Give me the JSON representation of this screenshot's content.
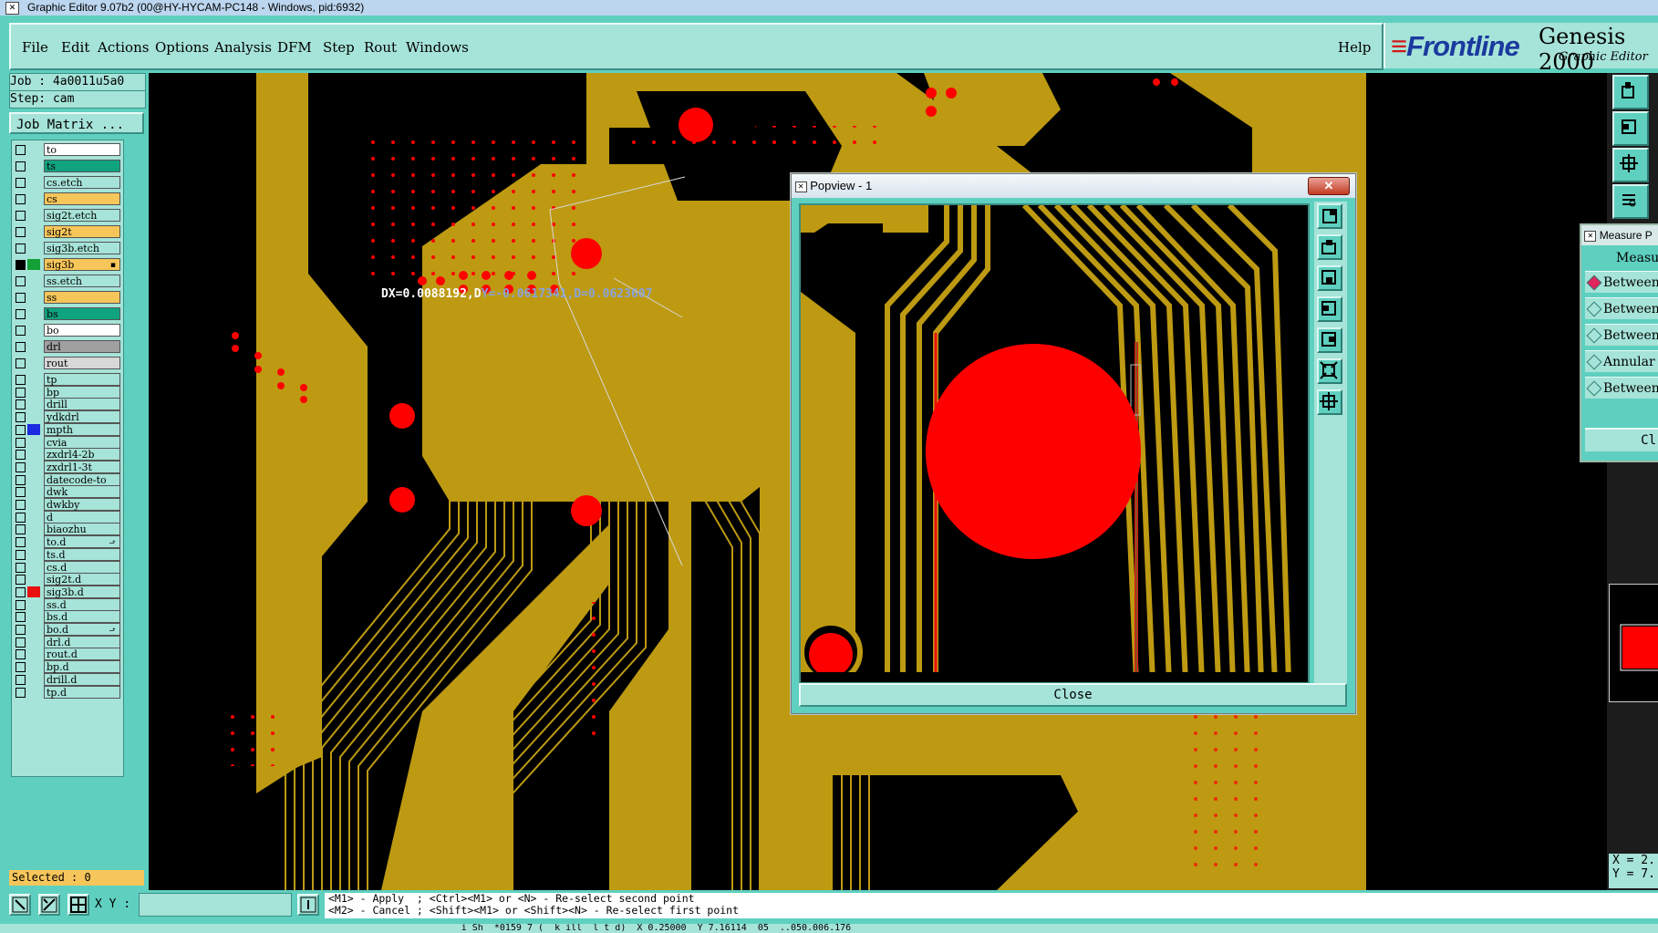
{
  "window": {
    "title": "Graphic Editor 9.07b2 (00@HY-HYCAM-PC148 - Windows, pid:6932)"
  },
  "menu": {
    "items": [
      "File",
      "Edit",
      "Actions",
      "Options",
      "Analysis",
      "DFM",
      "Step",
      "Rout",
      "Windows"
    ],
    "help": "Help"
  },
  "brand": {
    "logo": "Frontline",
    "product": "Genesis 2000",
    "subtitle": "Graphic Editor"
  },
  "job": {
    "job_label": "Job : 4a0011u5a0",
    "step_label": "Step: cam",
    "matrix_button": "Job Matrix ..."
  },
  "layers": [
    {
      "name": "to",
      "color": "#ffffff"
    },
    {
      "name": "ts",
      "color": "#0fa37f"
    },
    {
      "name": "cs.etch",
      "color": "#a6e3d8"
    },
    {
      "name": "cs",
      "color": "#f7c65a"
    },
    {
      "name": "sig2t.etch",
      "color": "#a6e3d8"
    },
    {
      "name": "sig2t",
      "color": "#f7c65a"
    },
    {
      "name": "sig3b.etch",
      "color": "#a6e3d8"
    },
    {
      "name": "sig3b",
      "color": "#f7c65a",
      "swatch": "#12a037",
      "active": true,
      "flag": "▪"
    },
    {
      "name": "ss.etch",
      "color": "#a6e3d8"
    },
    {
      "name": "ss",
      "color": "#f7c65a"
    },
    {
      "name": "bs",
      "color": "#0fa37f"
    },
    {
      "name": "bo",
      "color": "#ffffff"
    },
    {
      "name": "drl",
      "color": "#a0a0a0"
    },
    {
      "name": "rout",
      "color": "#d8d8d8"
    },
    {
      "name": "tp",
      "color": "#a6e3d8"
    },
    {
      "name": "bp",
      "color": "#a6e3d8"
    },
    {
      "name": "drill",
      "color": "#a6e3d8"
    },
    {
      "name": "ydkdrl",
      "color": "#a6e3d8"
    },
    {
      "name": "mpth",
      "color": "#a6e3d8",
      "swatch": "#1c2be0"
    },
    {
      "name": "cvia",
      "color": "#a6e3d8"
    },
    {
      "name": "zxdrl4-2b",
      "color": "#a6e3d8"
    },
    {
      "name": "zxdrl1-3t",
      "color": "#a6e3d8"
    },
    {
      "name": "datecode-to",
      "color": "#a6e3d8"
    },
    {
      "name": "dwk",
      "color": "#a6e3d8"
    },
    {
      "name": "dwkby",
      "color": "#a6e3d8"
    },
    {
      "name": "d",
      "color": "#a6e3d8"
    },
    {
      "name": "biaozhu",
      "color": "#a6e3d8"
    },
    {
      "name": "to.d",
      "color": "#a6e3d8",
      "flag": "⬏"
    },
    {
      "name": "ts.d",
      "color": "#a6e3d8"
    },
    {
      "name": "cs.d",
      "color": "#a6e3d8"
    },
    {
      "name": "sig2t.d",
      "color": "#a6e3d8"
    },
    {
      "name": "sig3b.d",
      "color": "#a6e3d8",
      "swatch": "#e81010"
    },
    {
      "name": "ss.d",
      "color": "#a6e3d8"
    },
    {
      "name": "bs.d",
      "color": "#a6e3d8"
    },
    {
      "name": "bo.d",
      "color": "#a6e3d8",
      "flag": "⬏"
    },
    {
      "name": "drl.d",
      "color": "#a6e3d8"
    },
    {
      "name": "rout.d",
      "color": "#a6e3d8"
    },
    {
      "name": "bp.d",
      "color": "#a6e3d8"
    },
    {
      "name": "drill.d",
      "color": "#a6e3d8"
    },
    {
      "name": "tp.d",
      "color": "#a6e3d8"
    }
  ],
  "selected": "Selected : 0",
  "measurement": {
    "readout_a": "DX=0.0088192,D",
    "readout_b": "Y=-0.0617341,D=0.0623607"
  },
  "popview": {
    "title": "Popview - 1",
    "close_label": "Close"
  },
  "measure_panel": {
    "title": "Measure P",
    "header": "Measu",
    "options": [
      "Between",
      "Between",
      "Between",
      "Annular",
      "Between"
    ],
    "close_partial": "Cl"
  },
  "bottom": {
    "xy_label": "X Y :",
    "xy_value": "",
    "hint_line1": "<M1> - Apply  ; <Ctrl><M1> or <N> - Re-select second point",
    "hint_line2": "<M2> - Cancel ; <Shift><M1> or <Shift><N> - Re-select first point",
    "status": "                                                                                    i Sh  *0159 7 (  k ill  l t d)  X 0.25000  Y 7.16114  05  ..050.006.176",
    "coord_x": "X = 2.",
    "coord_y": "Y = 7."
  },
  "colors": {
    "copper": "#bd9a12",
    "pad": "#ff0000",
    "panel": "#5fd0c0",
    "panel_light": "#a6e3d8"
  }
}
